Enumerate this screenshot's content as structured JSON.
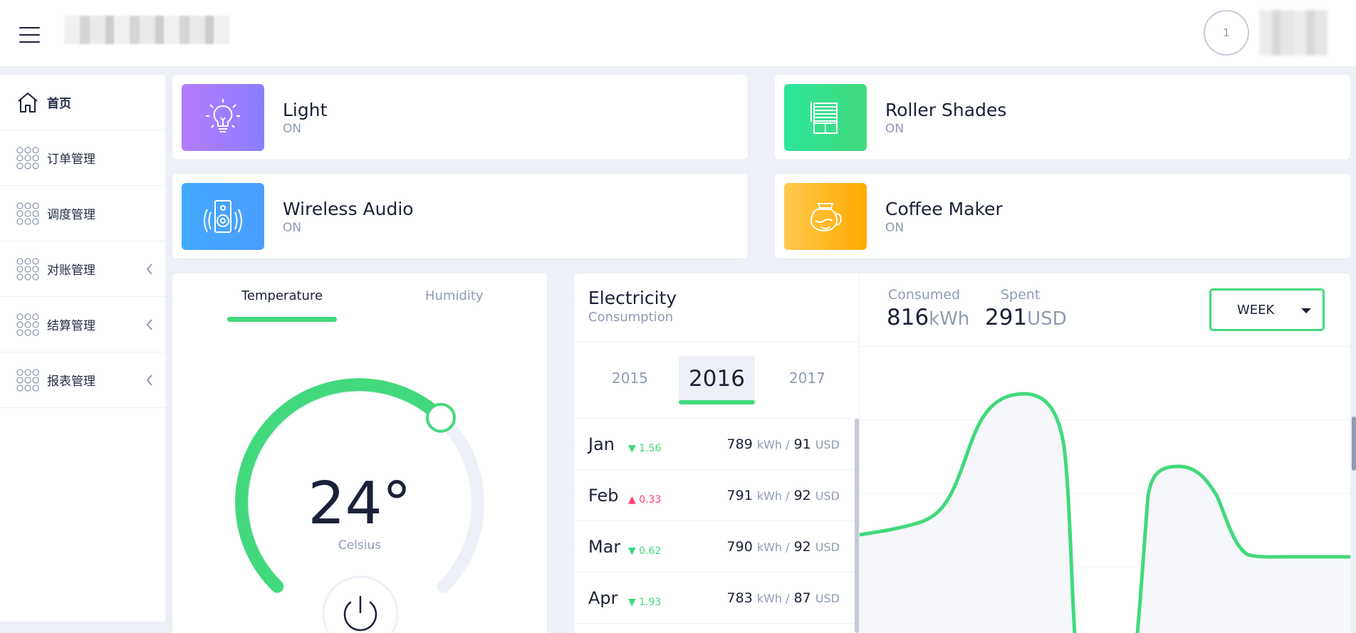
{
  "header": {
    "menu_icon": "hamburger-menu-icon",
    "avatar_text": "1"
  },
  "sidebar": {
    "items": [
      {
        "label": "首页",
        "icon": "home-icon",
        "active": true,
        "expandable": false
      },
      {
        "label": "订单管理",
        "icon": "grid-dots-icon",
        "expandable": false
      },
      {
        "label": "调度管理",
        "icon": "grid-dots-icon",
        "expandable": false
      },
      {
        "label": "对账管理",
        "icon": "grid-dots-icon",
        "expandable": true
      },
      {
        "label": "结算管理",
        "icon": "grid-dots-icon",
        "expandable": true
      },
      {
        "label": "报表管理",
        "icon": "grid-dots-icon",
        "expandable": true
      }
    ]
  },
  "devices": [
    {
      "name": "Light",
      "status": "ON",
      "icon": "lightbulb-icon",
      "colors": [
        "#b57bff",
        "#8a7fff"
      ]
    },
    {
      "name": "Roller Shades",
      "status": "ON",
      "icon": "roller-shades-icon",
      "colors": [
        "#2ce69b",
        "#42d97c"
      ]
    },
    {
      "name": "Wireless Audio",
      "status": "ON",
      "icon": "speaker-icon",
      "colors": [
        "#42aaff",
        "#4c9dff"
      ]
    },
    {
      "name": "Coffee Maker",
      "status": "ON",
      "icon": "coffee-pot-icon",
      "colors": [
        "#ffc94d",
        "#ffaa00"
      ]
    }
  ],
  "climate": {
    "tabs": [
      "Temperature",
      "Humidity"
    ],
    "active_tab": "Temperature",
    "value": "24°",
    "unit": "Celsius",
    "dial_fraction": 0.66,
    "accent": "#42d97c"
  },
  "electricity": {
    "title": "Electricity",
    "subtitle": "Consumption",
    "years": [
      "2015",
      "2016",
      "2017"
    ],
    "active_year": "2016",
    "months": [
      {
        "month": "Jan",
        "delta": "1.56",
        "dir": "down",
        "kwh": "789",
        "kwh_unit": "kWh /",
        "usd": "91",
        "usd_unit": "USD"
      },
      {
        "month": "Feb",
        "delta": "0.33",
        "dir": "up",
        "kwh": "791",
        "kwh_unit": "kWh /",
        "usd": "92",
        "usd_unit": "USD"
      },
      {
        "month": "Mar",
        "delta": "0.62",
        "dir": "down",
        "kwh": "790",
        "kwh_unit": "kWh /",
        "usd": "92",
        "usd_unit": "USD"
      },
      {
        "month": "Apr",
        "delta": "1.93",
        "dir": "down",
        "kwh": "783",
        "kwh_unit": "kWh /",
        "usd": "87",
        "usd_unit": "USD"
      }
    ],
    "consumed_label": "Consumed",
    "consumed_value": "816",
    "consumed_unit": "kWh",
    "spent_label": "Spent",
    "spent_value": "291",
    "spent_unit": "USD",
    "period": "WEEK"
  }
}
